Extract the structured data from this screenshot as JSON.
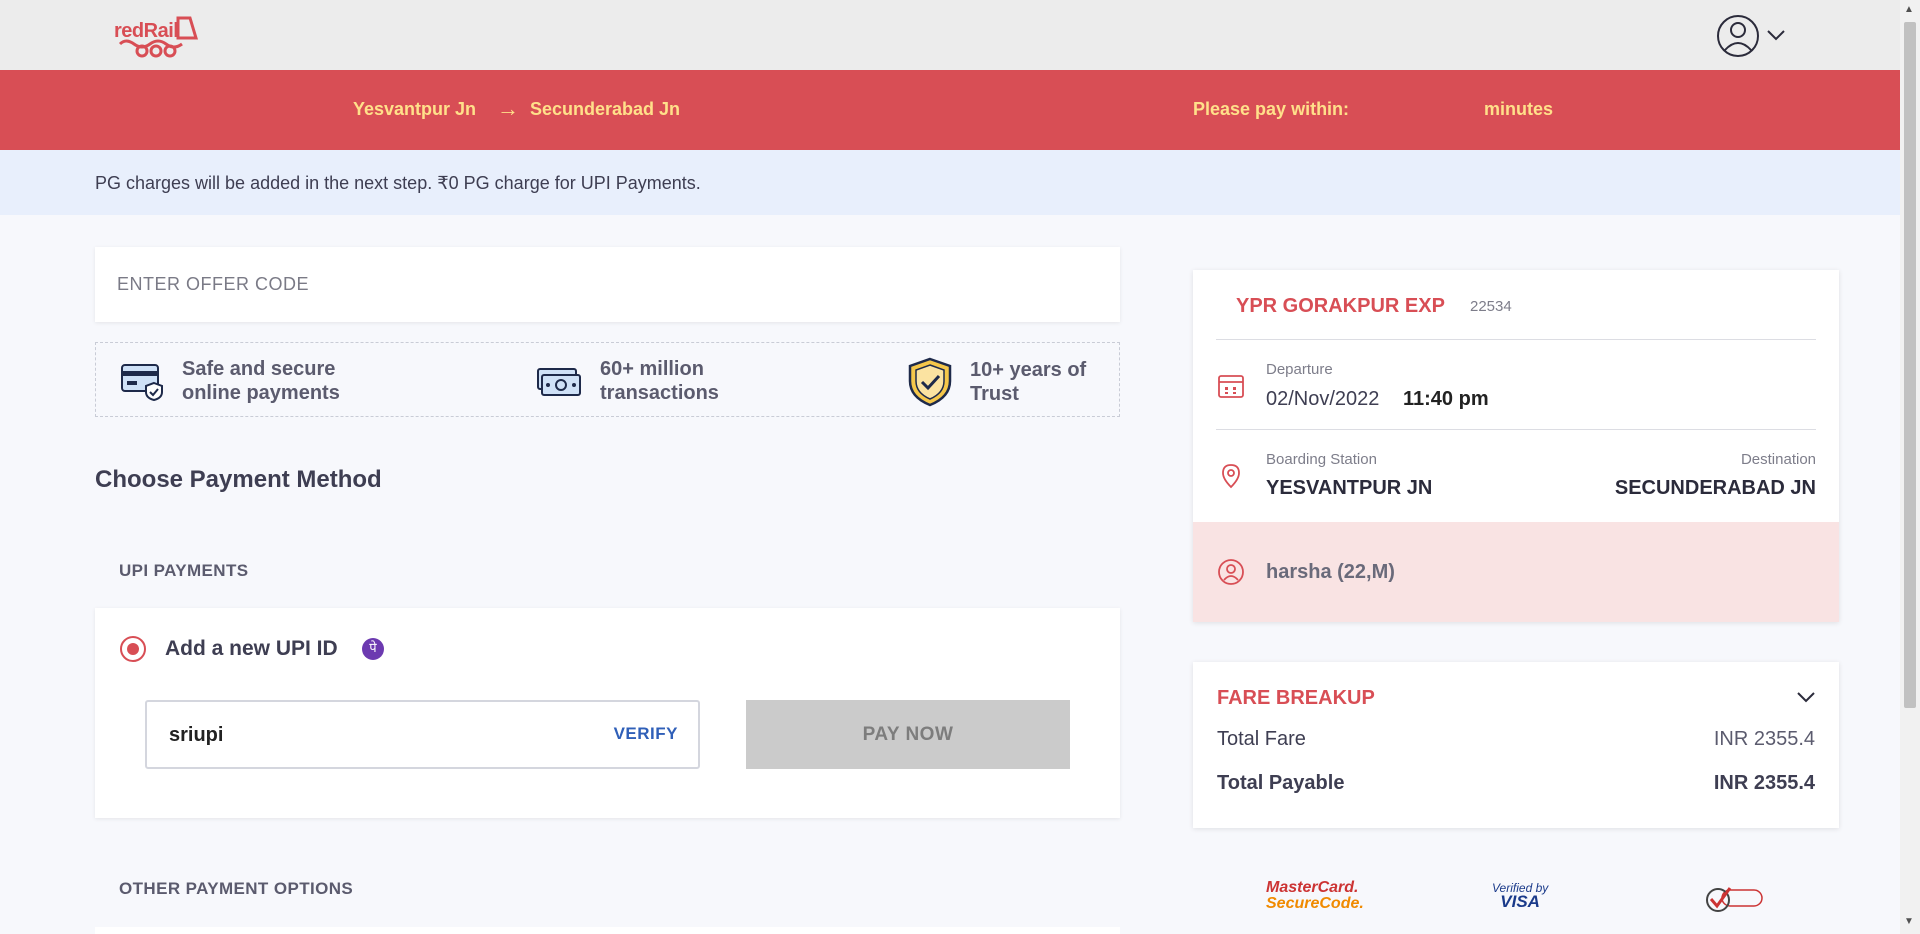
{
  "header": {
    "logo_text": "redRail"
  },
  "journey": {
    "from": "Yesvantpur Jn",
    "arrow": "→",
    "to": "Secunderabad Jn",
    "pay_within_label": "Please pay within:",
    "minutes_label": "minutes"
  },
  "info": {
    "text": "PG charges will be added in the next step. ₹0 PG charge for UPI Payments."
  },
  "offer": {
    "placeholder": "ENTER OFFER CODE"
  },
  "trust": [
    {
      "icon": "card-shield-icon",
      "text": "Safe and secure\nonline payments"
    },
    {
      "icon": "cash-icon",
      "text": "60+ million\ntransactions"
    },
    {
      "icon": "shield-check-icon",
      "text": "10+ years of\nTrust"
    }
  ],
  "payment": {
    "section_title": "Choose Payment Method",
    "upi_label": "UPI PAYMENTS",
    "upi_option_title": "Add a new UPI ID",
    "phonepe_glyph": "पे",
    "upi_input_value": "sriupi",
    "verify_label": "VERIFY",
    "pay_now_label": "PAY NOW",
    "other_label": "OTHER PAYMENT OPTIONS"
  },
  "train": {
    "name": "YPR GORAKPUR EXP",
    "number": "22534",
    "departure_label": "Departure",
    "departure_date": "02/Nov/2022",
    "departure_time": "11:40 pm",
    "boarding_label": "Boarding Station",
    "boarding_value": "YESVANTPUR JN",
    "destination_label": "Destination",
    "destination_value": "SECUNDERABAD JN",
    "passenger": "harsha (22,M)"
  },
  "fare": {
    "title": "FARE BREAKUP",
    "total_fare_label": "Total Fare",
    "total_fare_value": "INR 2355.4",
    "total_payable_label": "Total Payable",
    "total_payable_value": "INR 2355.4"
  },
  "badges": {
    "mastercard_line1": "MasterCard.",
    "mastercard_line2": "SecureCode.",
    "visa_line1": "Verified by",
    "visa_line2": "VISA"
  },
  "colors": {
    "brand_red": "#d84e55",
    "accent_yellow": "#ffe08a",
    "info_bg": "#e8effc",
    "verify_blue": "#2f5fb8"
  }
}
